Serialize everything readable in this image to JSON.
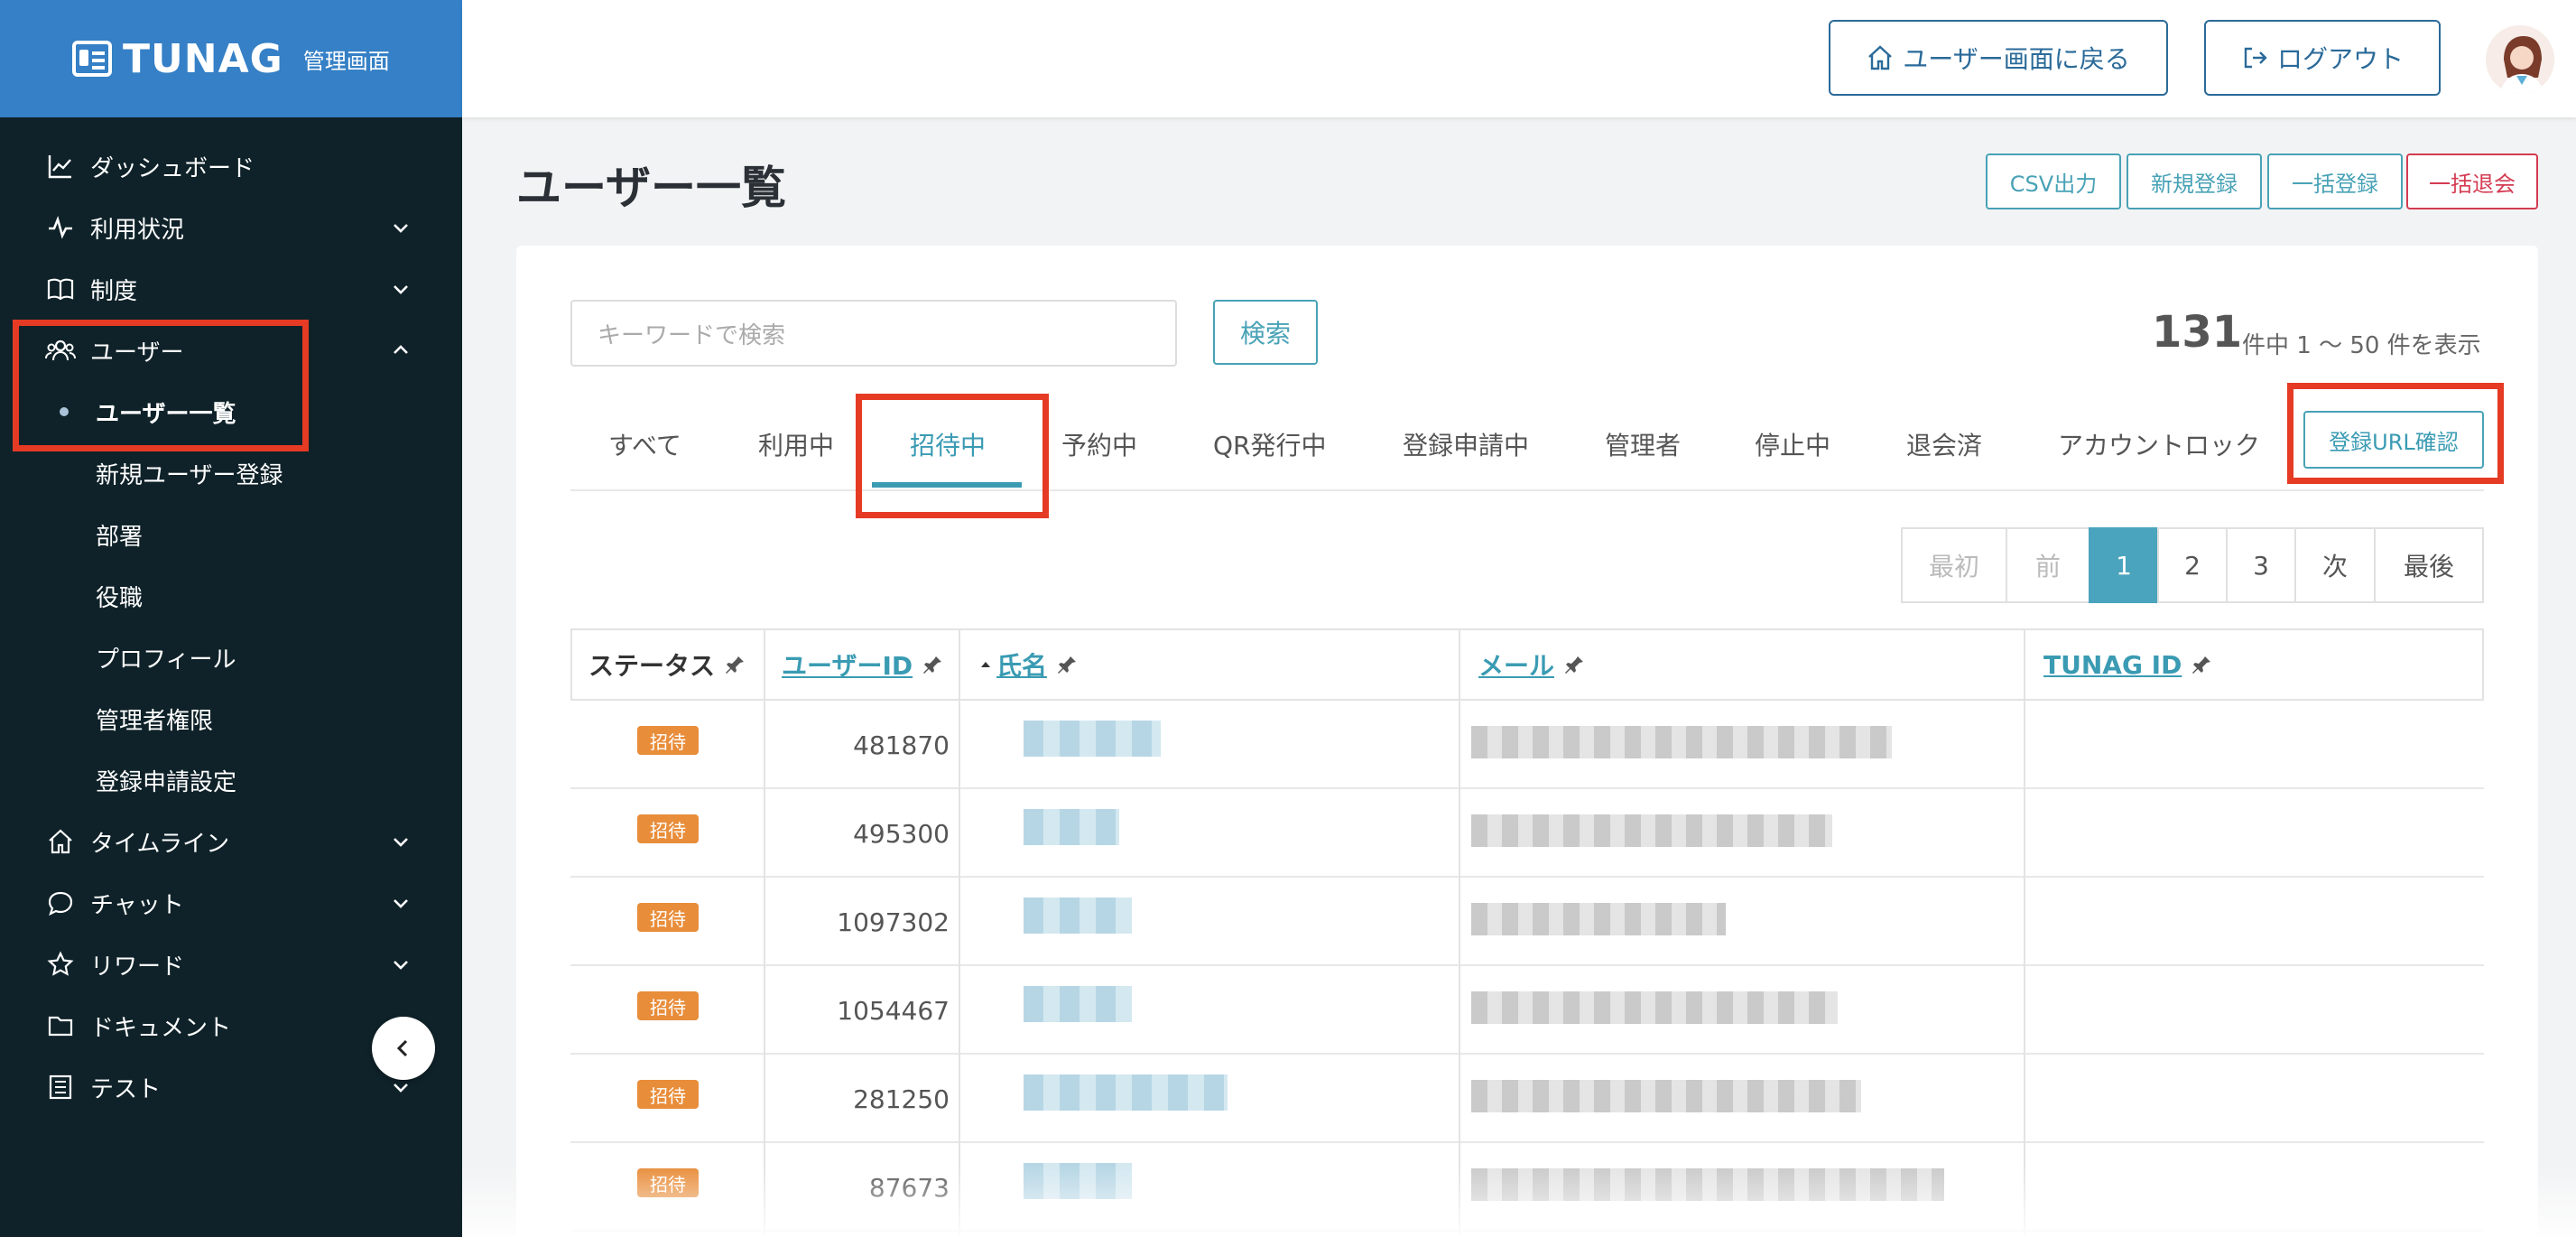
{
  "brand": {
    "name": "TUNAG",
    "sub": "管理画面"
  },
  "sidebar": {
    "items": [
      {
        "label": "ダッシュボード",
        "icon": "chart-icon"
      },
      {
        "label": "利用状況",
        "icon": "pulse-icon"
      },
      {
        "label": "制度",
        "icon": "book-icon"
      },
      {
        "label": "ユーザー",
        "icon": "users-icon"
      },
      {
        "label": "タイムライン",
        "icon": "home-icon"
      },
      {
        "label": "チャット",
        "icon": "chat-icon"
      },
      {
        "label": "リワード",
        "icon": "star-icon"
      },
      {
        "label": "ドキュメント",
        "icon": "folder-icon"
      },
      {
        "label": "テスト",
        "icon": "list-icon"
      }
    ],
    "user_submenu": [
      "ユーザー一覧",
      "新規ユーザー登録",
      "部署",
      "役職",
      "プロフィール",
      "管理者権限",
      "登録申請設定"
    ]
  },
  "header": {
    "back_label": "ユーザー画面に戻る",
    "logout_label": "ログアウト"
  },
  "page": {
    "title": "ユーザー一覧",
    "actions": [
      "CSV出力",
      "新規登録",
      "一括登録",
      "一括退会"
    ]
  },
  "search": {
    "placeholder": "キーワードで検索",
    "button": "検索"
  },
  "summary": {
    "total": "131",
    "text": "件中 1 〜 50 件を表示"
  },
  "tabs": [
    "すべて",
    "利用中",
    "招待中",
    "予約中",
    "QR発行中",
    "登録申請中",
    "管理者",
    "停止中",
    "退会済",
    "アカウントロック"
  ],
  "active_tab": "招待中",
  "url_button": "登録URL確認",
  "pagination": [
    "最初",
    "前",
    "1",
    "2",
    "3",
    "次",
    "最後"
  ],
  "table": {
    "headers": [
      "ステータス",
      "ユーザーID",
      "氏名",
      "メール",
      "TUNAG ID"
    ],
    "rows": [
      {
        "status": "招待",
        "id": "481870"
      },
      {
        "status": "招待",
        "id": "495300"
      },
      {
        "status": "招待",
        "id": "1097302"
      },
      {
        "status": "招待",
        "id": "1054467"
      },
      {
        "status": "招待",
        "id": "281250"
      },
      {
        "status": "招待",
        "id": "87673"
      }
    ]
  },
  "colors": {
    "brand": "#3580c6",
    "sidebar": "#0f2229",
    "accent": "#48a2b6",
    "danger": "#d43b52",
    "badge": "#e88d3a",
    "highlight": "#e53b24"
  }
}
